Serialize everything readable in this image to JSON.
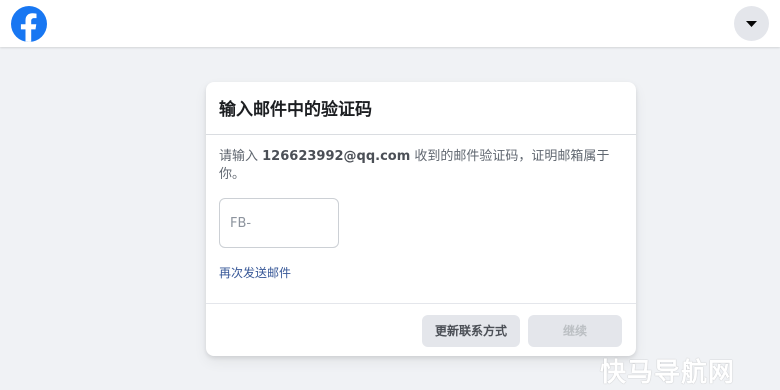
{
  "topbar": {
    "logo_icon": "facebook-f-logo-icon",
    "brand_color": "#1877f2",
    "menu_icon": "caret-down-icon"
  },
  "dialog": {
    "title": "输入邮件中的验证码",
    "description_prefix": "请输入 ",
    "email": "126623992@qq.com",
    "description_suffix": " 收到的邮件验证码，证明邮箱属于你。",
    "code_input": {
      "value": "",
      "placeholder": "FB-"
    },
    "resend_link": "再次发送邮件",
    "update_contact_button": "更新联系方式",
    "continue_button": "继续"
  },
  "watermark": {
    "text": "快马导航网"
  }
}
